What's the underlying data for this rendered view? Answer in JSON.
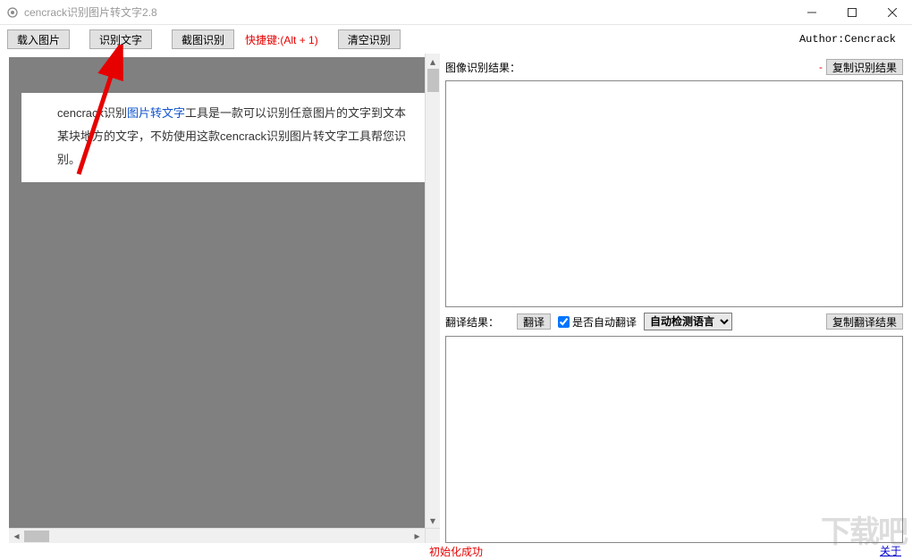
{
  "window": {
    "title": "cencrack识别图片转文字2.8"
  },
  "toolbar": {
    "load_image": "载入图片",
    "recognize_text": "识别文字",
    "screenshot_recognize": "截图识别",
    "hotkey": "快捷键:(Alt + 1)",
    "clear_recognition": "清空识别",
    "author": "Author:Cencrack"
  },
  "sample": {
    "line1_pre": "cencrack识别",
    "line1_link": "图片转文字",
    "line1_post": "工具是一款可以识别任意图片的文字到文本",
    "line2": "某块地方的文字，不妨使用这款cencrack识别图片转文字工具帮您识别。"
  },
  "ocr": {
    "label": "图像识别结果：",
    "dash": "-",
    "copy_btn": "复制识别结果"
  },
  "translate": {
    "label": "翻译结果：",
    "translate_btn": "翻译",
    "auto_checkbox": "是否自动翻译",
    "lang_selected": "自动检测语言",
    "copy_btn": "复制翻译结果"
  },
  "status": {
    "message": "初始化成功",
    "about": "关于"
  },
  "watermark": "下载吧"
}
